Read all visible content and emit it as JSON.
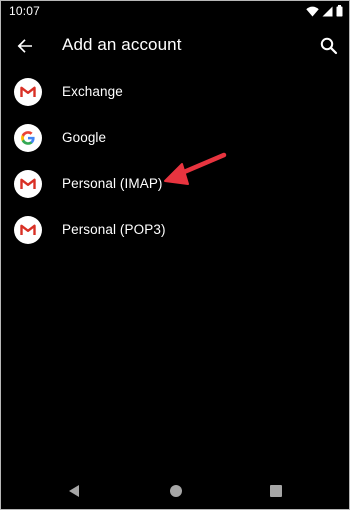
{
  "status_bar": {
    "time": "10:07",
    "icons": [
      "wifi-icon",
      "signal-icon",
      "battery-icon"
    ]
  },
  "app_bar": {
    "title": "Add an account",
    "back_icon": "arrow-back-icon",
    "search_icon": "search-icon"
  },
  "accounts": [
    {
      "label": "Exchange",
      "icon": "gmail-icon"
    },
    {
      "label": "Google",
      "icon": "google-icon"
    },
    {
      "label": "Personal (IMAP)",
      "icon": "gmail-icon"
    },
    {
      "label": "Personal (POP3)",
      "icon": "gmail-icon"
    }
  ],
  "annotation": {
    "target": "Personal (IMAP)",
    "color": "#e8343f"
  },
  "nav_bar": {
    "icons": [
      "nav-back-icon",
      "nav-home-icon",
      "nav-recents-icon"
    ]
  },
  "colors": {
    "background": "#000000",
    "text": "#ffffff",
    "gmail_red": "#d93025",
    "nav_gray": "#a6a6a6"
  }
}
